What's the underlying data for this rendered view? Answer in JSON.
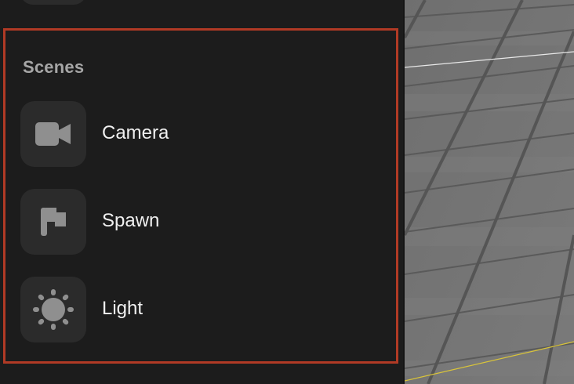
{
  "scenes": {
    "title": "Scenes",
    "items": [
      {
        "label": "Camera",
        "icon": "video-camera-icon"
      },
      {
        "label": "Spawn",
        "icon": "flag-icon"
      },
      {
        "label": "Light",
        "icon": "sun-icon"
      }
    ]
  },
  "colors": {
    "panel_bg": "#1c1c1c",
    "item_bg": "#2b2b2b",
    "highlight_border": "#b13a25",
    "title_text": "#a6a6a6",
    "label_text": "#f0f0f0",
    "icon_fill": "#8f8f8f"
  }
}
